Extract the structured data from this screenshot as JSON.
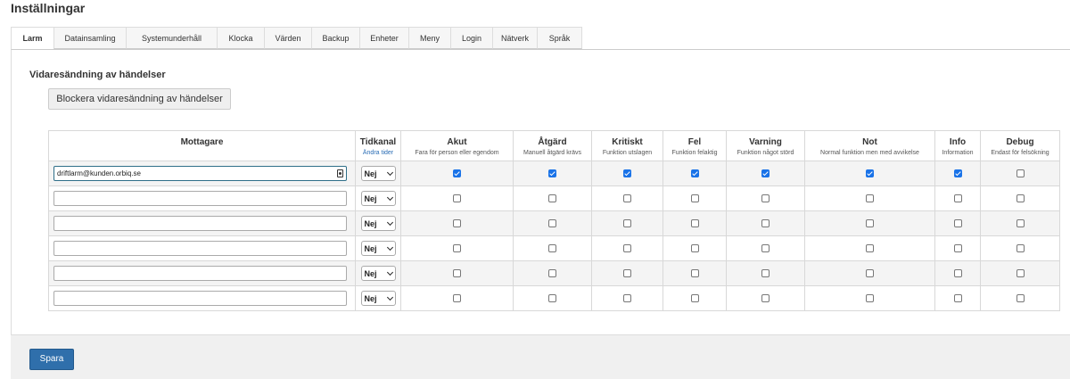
{
  "page_title": "Inställningar",
  "tabs": [
    {
      "label": "Larm",
      "active": true
    },
    {
      "label": "Datainsamling"
    },
    {
      "label": "Systemunderhåll"
    },
    {
      "label": "Klocka"
    },
    {
      "label": "Värden"
    },
    {
      "label": "Backup"
    },
    {
      "label": "Enheter"
    },
    {
      "label": "Meny"
    },
    {
      "label": "Login"
    },
    {
      "label": "Nätverk"
    },
    {
      "label": "Språk"
    }
  ],
  "section": {
    "title": "Vidaresändning av händelser",
    "block_button_label": "Blockera vidaresändning av händelser"
  },
  "table": {
    "recipient_header": "Mottagare",
    "time_channel_header": "Tidkanal",
    "time_channel_link": "Ändra tider",
    "levels": [
      {
        "title": "Akut",
        "subtitle": "Fara för person eller egendom"
      },
      {
        "title": "Åtgärd",
        "subtitle": "Manuell åtgärd krävs"
      },
      {
        "title": "Kritiskt",
        "subtitle": "Funktion utslagen"
      },
      {
        "title": "Fel",
        "subtitle": "Funktion felaktig"
      },
      {
        "title": "Varning",
        "subtitle": "Funktion något störd"
      },
      {
        "title": "Not",
        "subtitle": "Normal funktion men med avvikelse"
      },
      {
        "title": "Info",
        "subtitle": "Information"
      },
      {
        "title": "Debug",
        "subtitle": "Endast för felsökning"
      }
    ],
    "rows": [
      {
        "recipient": "driftlarm@kunden.orbiq.se",
        "time_channel": "Nej",
        "checks": [
          true,
          true,
          true,
          true,
          true,
          true,
          true,
          false
        ]
      },
      {
        "recipient": "",
        "time_channel": "Nej",
        "checks": [
          false,
          false,
          false,
          false,
          false,
          false,
          false,
          false
        ]
      },
      {
        "recipient": "",
        "time_channel": "Nej",
        "checks": [
          false,
          false,
          false,
          false,
          false,
          false,
          false,
          false
        ]
      },
      {
        "recipient": "",
        "time_channel": "Nej",
        "checks": [
          false,
          false,
          false,
          false,
          false,
          false,
          false,
          false
        ]
      },
      {
        "recipient": "",
        "time_channel": "Nej",
        "checks": [
          false,
          false,
          false,
          false,
          false,
          false,
          false,
          false
        ]
      },
      {
        "recipient": "",
        "time_channel": "Nej",
        "checks": [
          false,
          false,
          false,
          false,
          false,
          false,
          false,
          false
        ]
      }
    ]
  },
  "footer": {
    "save_label": "Spara"
  },
  "colors": {
    "checkbox_accent": "#1a73e8",
    "save_button": "#2f6fab",
    "link": "#2a6db5"
  }
}
